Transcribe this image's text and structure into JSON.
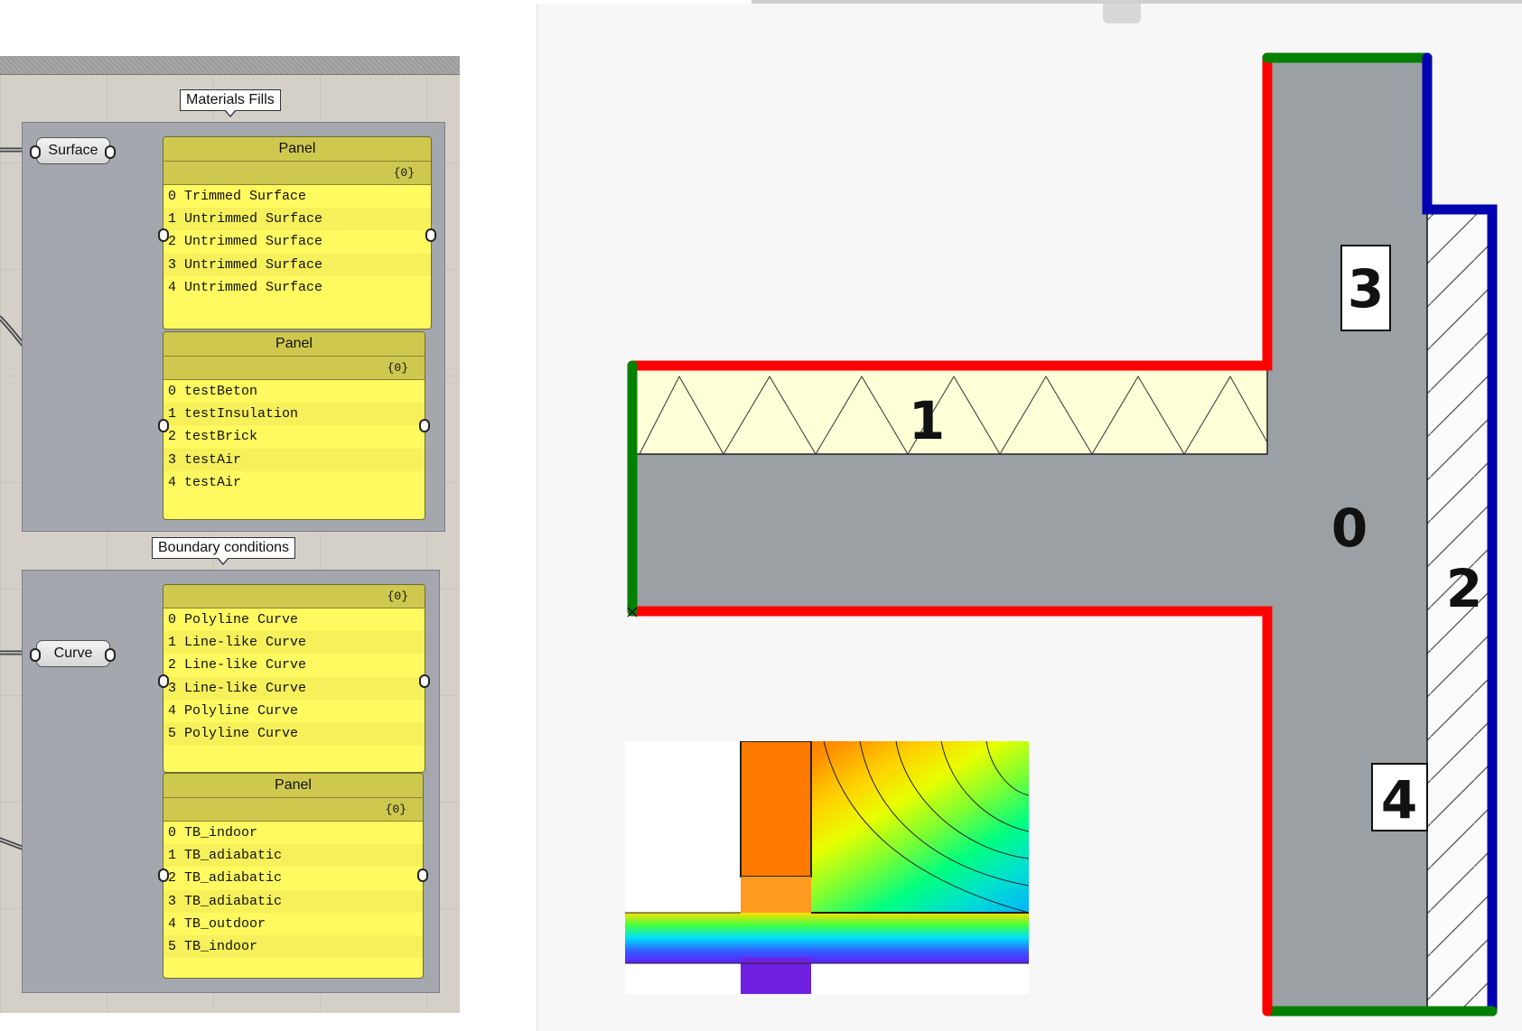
{
  "grasshopper": {
    "materials_group": {
      "label": "Materials Fills",
      "param": "Surface",
      "panel_surfaces": {
        "title": "Panel",
        "path": "{0}",
        "rows": [
          "Trimmed Surface",
          "Untrimmed Surface",
          "Untrimmed Surface",
          "Untrimmed Surface",
          "Untrimmed Surface"
        ]
      },
      "panel_materials": {
        "title": "Panel",
        "path": "{0}",
        "rows": [
          "testBeton",
          "testInsulation",
          "testBrick",
          "testAir",
          "testAir"
        ]
      }
    },
    "boundary_group": {
      "label": "Boundary conditions",
      "param": "Curve",
      "panel_curves": {
        "title": "",
        "path": "{0}",
        "rows": [
          "Polyline Curve",
          "Line-like Curve",
          "Line-like Curve",
          "Line-like Curve",
          "Polyline Curve",
          "Polyline Curve"
        ]
      },
      "panel_boundaries": {
        "title": "Panel",
        "path": "{0}",
        "rows": [
          "TB_indoor",
          "TB_adiabatic",
          "TB_adiabatic",
          "TB_adiabatic",
          "TB_outdoor",
          "TB_indoor"
        ]
      }
    }
  },
  "viewport": {
    "labels": {
      "concrete": "0",
      "insulation": "1",
      "brick": "2",
      "air_top": "3",
      "air_bottom": "4"
    },
    "colors": {
      "indoor": "#ff0000",
      "adiabatic": "#008000",
      "outdoor": "#0000b0",
      "concrete": "#9aa0a3",
      "insulation": "#ffffd8"
    }
  }
}
